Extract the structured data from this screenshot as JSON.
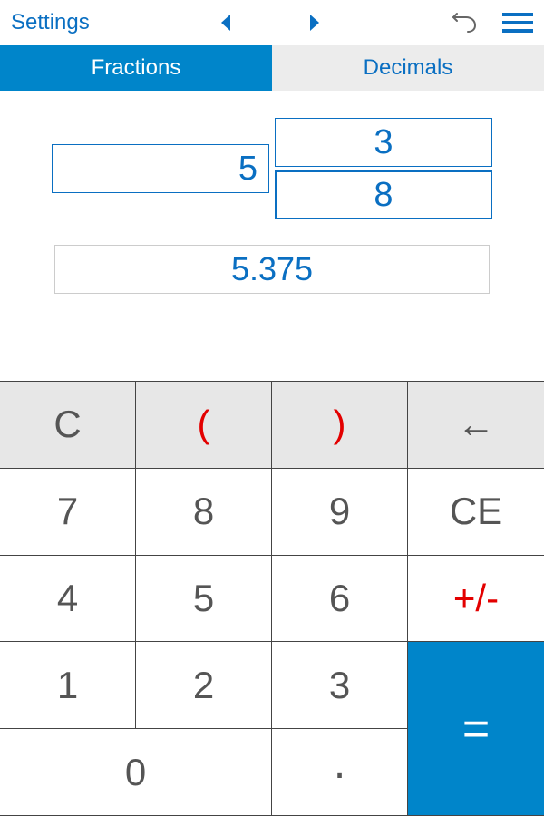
{
  "header": {
    "settings_label": "Settings"
  },
  "tabs": {
    "fractions": "Fractions",
    "decimals": "Decimals"
  },
  "input": {
    "whole": "5",
    "numerator": "3",
    "denominator": "8",
    "result": "5.375"
  },
  "keys": {
    "clear": "C",
    "lparen": "(",
    "rparen": ")",
    "backspace": "←",
    "k7": "7",
    "k8": "8",
    "k9": "9",
    "clear_entry": "CE",
    "k4": "4",
    "k5": "5",
    "k6": "6",
    "sign": "+/-",
    "k1": "1",
    "k2": "2",
    "k3": "3",
    "equals": "=",
    "k0": "0",
    "dot": "."
  },
  "colors": {
    "accent": "#0085ca",
    "link": "#0a6fc2",
    "red": "#e30000"
  }
}
